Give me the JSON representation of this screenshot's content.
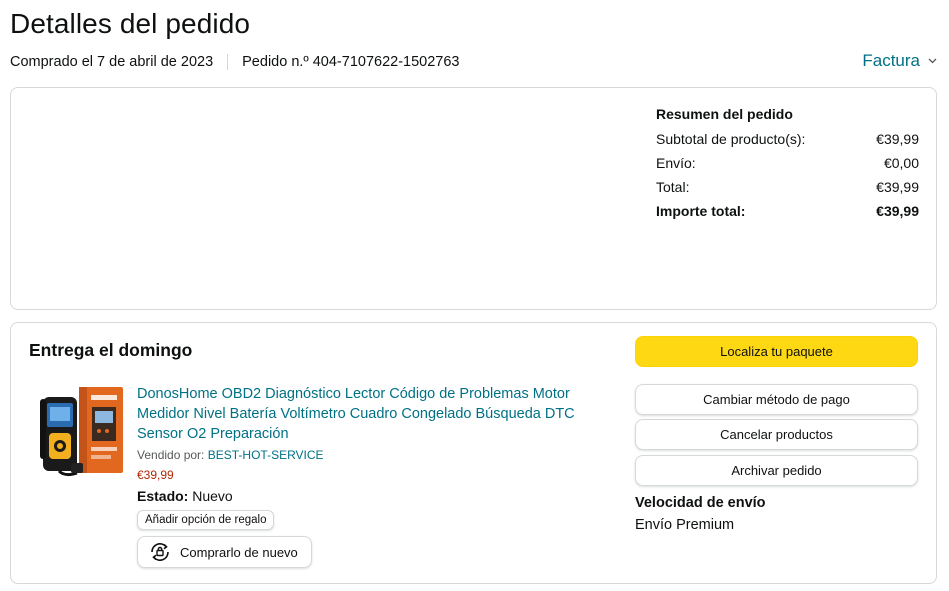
{
  "header": {
    "title": "Detalles del pedido",
    "purchase_date": "Comprado el 7 de abril de 2023",
    "order_number": "Pedido n.º 404-7107622-1502763",
    "invoice_label": "Factura"
  },
  "summary": {
    "title": "Resumen del pedido",
    "rows": [
      {
        "label": "Subtotal de producto(s):",
        "value": "€39,99"
      },
      {
        "label": "Envío:",
        "value": "€0,00"
      },
      {
        "label": "Total:",
        "value": "€39,99"
      },
      {
        "label": "Importe total:",
        "value": "€39,99"
      }
    ]
  },
  "delivery": {
    "title": "Entrega el domingo",
    "product": {
      "title": "DonosHome OBD2 Diagnóstico Lector Código de Problemas Motor Medidor Nivel Batería Voltímetro Cuadro Congelado Búsqueda DTC Sensor O2 Preparación",
      "seller_prefix": "Vendido por:",
      "seller_name": "BEST-HOT-SERVICE",
      "price": "€39,99",
      "state_label": "Estado:",
      "state_value": "Nuevo",
      "gift_label": "Añadir opción de regalo",
      "buy_again_label": "Comprarlo de nuevo"
    },
    "actions": {
      "track": "Localiza tu paquete",
      "change_payment": "Cambiar método de pago",
      "cancel": "Cancelar productos",
      "archive": "Archivar pedido"
    },
    "shipping": {
      "title": "Velocidad de envío",
      "value": "Envío Premium"
    }
  },
  "colors": {
    "link": "#007185",
    "price": "#b12704",
    "primary_button": "#ffd814",
    "border": "#d5d9d9",
    "text": "#0f1111"
  },
  "icons": [
    "chevron-down-icon",
    "buy-again-icon"
  ]
}
